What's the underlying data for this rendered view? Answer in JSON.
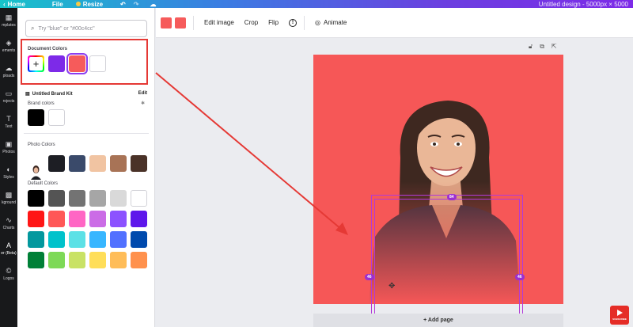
{
  "topbar": {
    "home": "Home",
    "file": "File",
    "resize": "Resize",
    "title": "Untitled design - 5000px × 5000"
  },
  "rail": {
    "items": [
      {
        "label": "mplates",
        "icon": "▦"
      },
      {
        "label": "ements",
        "icon": "◈"
      },
      {
        "label": "ploads",
        "icon": "☁"
      },
      {
        "label": "rojects",
        "icon": "▭"
      },
      {
        "label": "Text",
        "icon": "T"
      },
      {
        "label": "Photos",
        "icon": "▣"
      },
      {
        "label": "Styles",
        "icon": "◐"
      },
      {
        "label": "kground",
        "icon": "▩"
      },
      {
        "label": "Charts",
        "icon": "∿"
      },
      {
        "label": "er (Beta)",
        "icon": "A"
      },
      {
        "label": "Logos",
        "icon": "©"
      }
    ]
  },
  "panel": {
    "search_placeholder": "Try \"blue\" or \"#00c4cc\"",
    "document_colors_label": "Document Colors",
    "document_colors": [
      "#7d2ae8",
      "#f65b5b",
      "#ffffff"
    ],
    "brand_kit_label": "Untitled Brand Kit",
    "brand_kit_edit": "Edit",
    "brand_colors_label": "Brand colors",
    "brand_colors": [
      "#000000",
      "#ffffff"
    ],
    "photo_colors_label": "Photo Colors",
    "photo_colors": [
      "#1d1e24",
      "#3a4a6a",
      "#f1c4a2",
      "#a87356",
      "#4a3228"
    ],
    "default_colors_label": "Default Colors",
    "default_colors": [
      [
        "#000000",
        "#545454",
        "#737373",
        "#a6a6a6",
        "#d9d9d9",
        "#ffffff"
      ],
      [
        "#ff1616",
        "#ff5757",
        "#ff66c4",
        "#cb6ce6",
        "#8c52ff",
        "#5e17eb"
      ],
      [
        "#03989e",
        "#00c2cb",
        "#5ce1e6",
        "#38b6ff",
        "#5271ff",
        "#004aad"
      ],
      [
        "#008037",
        "#7ed957",
        "#c9e265",
        "#ffde59",
        "#ffbd59",
        "#ff914d"
      ]
    ]
  },
  "ctxbar": {
    "edit_image": "Edit image",
    "crop": "Crop",
    "flip": "Flip",
    "animate": "Animate"
  },
  "canvas": {
    "add_page": "+ Add page",
    "handle_top": "84",
    "handle_left": "46",
    "handle_right": "46",
    "page_color": "#f65757"
  },
  "watermark": {
    "text": "SUBSCRIBE"
  }
}
